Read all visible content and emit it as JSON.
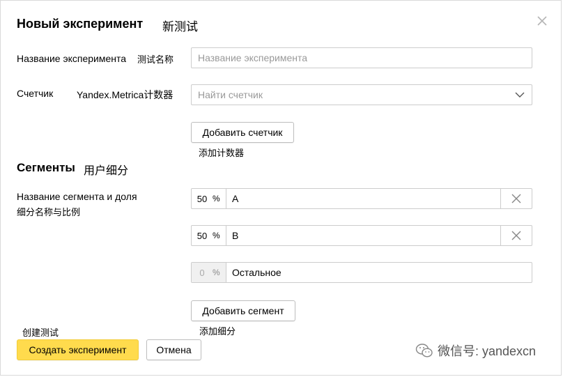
{
  "dialog": {
    "title": "Новый эксперимент",
    "title_cn": "新测试"
  },
  "experiment_name": {
    "label": "Название эксперимента",
    "label_cn": "测试名称",
    "placeholder": "Название эксперимента",
    "value": ""
  },
  "counter": {
    "label": "Счетчик",
    "label_cn": "Yandex.Metrica计数器",
    "placeholder": "Найти счетчик",
    "add_button": "Добавить счетчик",
    "add_button_cn": "添加计数器"
  },
  "segments": {
    "title": "Сегменты",
    "title_cn": "用户细分",
    "label_line1": "Название сегмента и доля",
    "label_cn": "细分名称与比例",
    "percent_sign": "%",
    "items": [
      {
        "percent": "50",
        "name": "A"
      },
      {
        "percent": "50",
        "name": "B"
      }
    ],
    "rest": {
      "percent": "0",
      "name": "Остальное"
    },
    "add_button": "Добавить сегмент",
    "add_button_cn": "添加细分"
  },
  "footer": {
    "create_cn": "创建测试",
    "create_button": "Создать эксперимент",
    "cancel_button": "Отмена"
  },
  "watermark": {
    "text": "微信号: yandexcn"
  },
  "colors": {
    "primary_button": "#ffdb4d",
    "border": "#cccccc",
    "placeholder": "#999999"
  }
}
